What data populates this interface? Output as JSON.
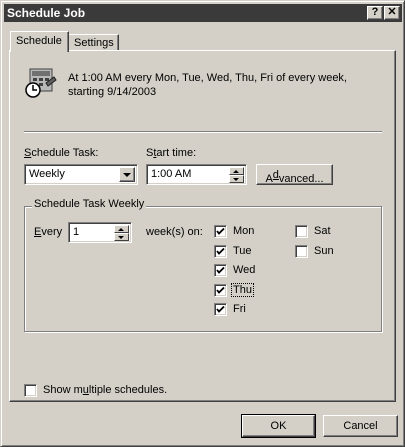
{
  "window": {
    "title": "Schedule Job",
    "help_glyph": "?",
    "close_glyph": "✕"
  },
  "tabs": [
    {
      "label": "Schedule",
      "active": true
    },
    {
      "label": "Settings",
      "active": false
    }
  ],
  "summary": {
    "icon": "scheduled-task-clock-icon",
    "line1": "At 1:00 AM every Mon, Tue, Wed, Thu, Fri of every week,",
    "line2": "starting 9/14/2003"
  },
  "schedule_task": {
    "label_pre": "",
    "label_mnemonic": "S",
    "label_post": "chedule Task:",
    "value": "Weekly"
  },
  "start_time": {
    "label_pre": "S",
    "label_mnemonic": "t",
    "label_post": "art time:",
    "value": "1:00 AM"
  },
  "advanced_button": {
    "label_pre": "A",
    "label_mnemonic": "d",
    "label_post": "vanced..."
  },
  "weekly_group": {
    "title": "Schedule Task Weekly",
    "every_label_pre": "",
    "every_mnemonic": "E",
    "every_label_post": "very",
    "every_value": "1",
    "weeks_on_label": "week(s) on:",
    "days": [
      {
        "label": "Mon",
        "checked": true
      },
      {
        "label": "Tue",
        "checked": true
      },
      {
        "label": "Wed",
        "checked": true
      },
      {
        "label": "Thu",
        "checked": true
      },
      {
        "label": "Fri",
        "checked": true
      },
      {
        "label": "Sat",
        "checked": false
      },
      {
        "label": "Sun",
        "checked": false
      }
    ]
  },
  "multiple_schedules": {
    "label_pre": "Show m",
    "label_mnemonic": "u",
    "label_post": "ltiple schedules.",
    "checked": false
  },
  "footer": {
    "ok_label": "OK",
    "cancel_label": "Cancel"
  }
}
